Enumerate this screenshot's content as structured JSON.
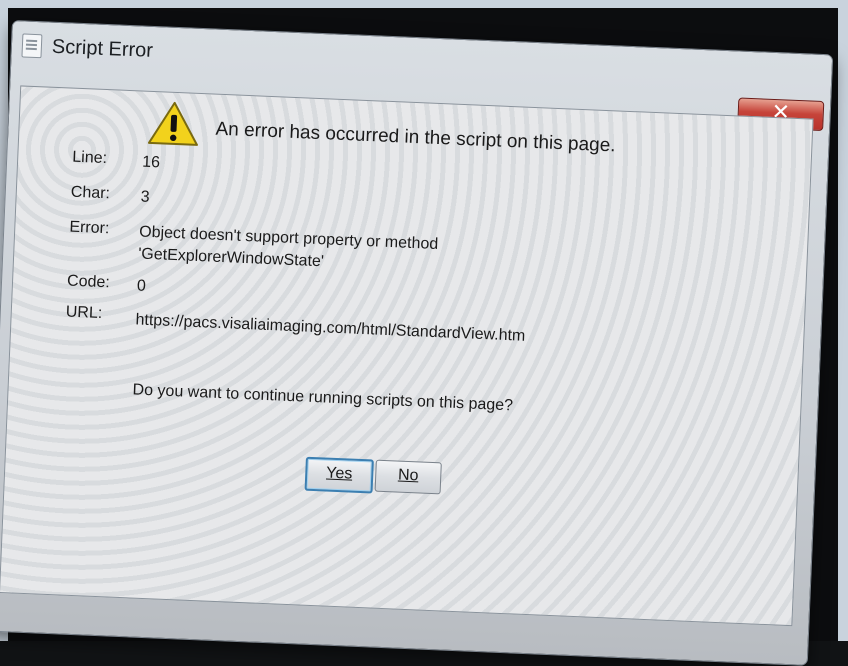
{
  "window": {
    "title": "Script Error",
    "close_glyph": "✕"
  },
  "dialog": {
    "headline": "An error has occurred in the script on this page.",
    "warning_icon": "warning-icon",
    "fields": {
      "line": {
        "label": "Line:",
        "value": "16"
      },
      "char": {
        "label": "Char:",
        "value": "3"
      },
      "error": {
        "label": "Error:",
        "value": "Object doesn't support property or method 'GetExplorerWindowState'"
      },
      "code": {
        "label": "Code:",
        "value": "0"
      },
      "url": {
        "label": "URL:",
        "value": "https://pacs.visaliaimaging.com/html/StandardView.htm"
      }
    },
    "question": "Do you want to continue running scripts on this page?",
    "buttons": {
      "yes": "Yes",
      "no": "No"
    }
  },
  "colors": {
    "close_button": "#c6443a",
    "warning_yellow": "#f2d21c",
    "focus_border": "#3c7fb1"
  }
}
